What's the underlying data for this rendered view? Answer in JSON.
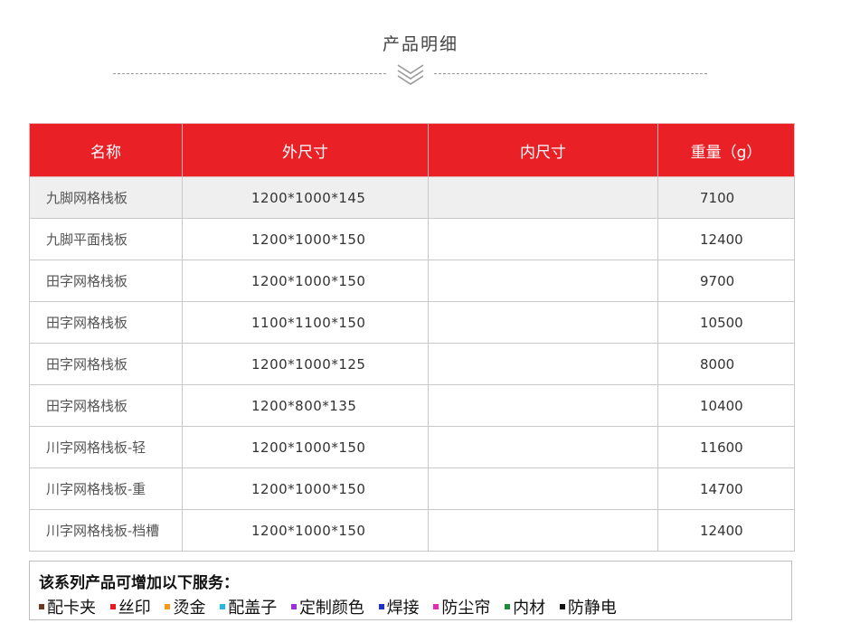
{
  "section_title": "产品明细",
  "table": {
    "headers": [
      "名称",
      "外尺寸",
      "内尺寸",
      "重量（g）"
    ],
    "rows": [
      {
        "name": "九脚网格栈板",
        "outer": "1200*1000*145",
        "inner": "",
        "weight": "7100"
      },
      {
        "name": "九脚平面栈板",
        "outer": "1200*1000*150",
        "inner": "",
        "weight": "12400"
      },
      {
        "name": "田字网格栈板",
        "outer": "1200*1000*150",
        "inner": "",
        "weight": "9700"
      },
      {
        "name": "田字网格栈板",
        "outer": "1100*1100*150",
        "inner": "",
        "weight": "10500"
      },
      {
        "name": "田字网格栈板",
        "outer": "1200*1000*125",
        "inner": "",
        "weight": "8000"
      },
      {
        "name": "田字网格栈板",
        "outer": "1200*800*135",
        "inner": "",
        "weight": "10400"
      },
      {
        "name": "川字网格栈板-轻",
        "outer": "1200*1000*150",
        "inner": "",
        "weight": "11600"
      },
      {
        "name": "川字网格栈板-重",
        "outer": "1200*1000*150",
        "inner": "",
        "weight": "14700"
      },
      {
        "name": "川字网格栈板-档槽",
        "outer": "1200*1000*150",
        "inner": "",
        "weight": "12400"
      }
    ]
  },
  "services": {
    "title": "该系列产品可增加以下服务：",
    "items": [
      {
        "label": "配卡夹",
        "color": "#6b3a1e"
      },
      {
        "label": "丝印",
        "color": "#e8191f"
      },
      {
        "label": "烫金",
        "color": "#f59a1b"
      },
      {
        "label": "配盖子",
        "color": "#21b8e6"
      },
      {
        "label": "定制颜色",
        "color": "#9b30d9"
      },
      {
        "label": "焊接",
        "color": "#1e2fd6"
      },
      {
        "label": "防尘帘",
        "color": "#e62ab8"
      },
      {
        "label": "内材",
        "color": "#1f8a3a"
      },
      {
        "label": "防静电",
        "color": "#111111"
      }
    ]
  },
  "colors": {
    "header_bg": "#ea2027",
    "first_row_bg": "#efefef"
  }
}
